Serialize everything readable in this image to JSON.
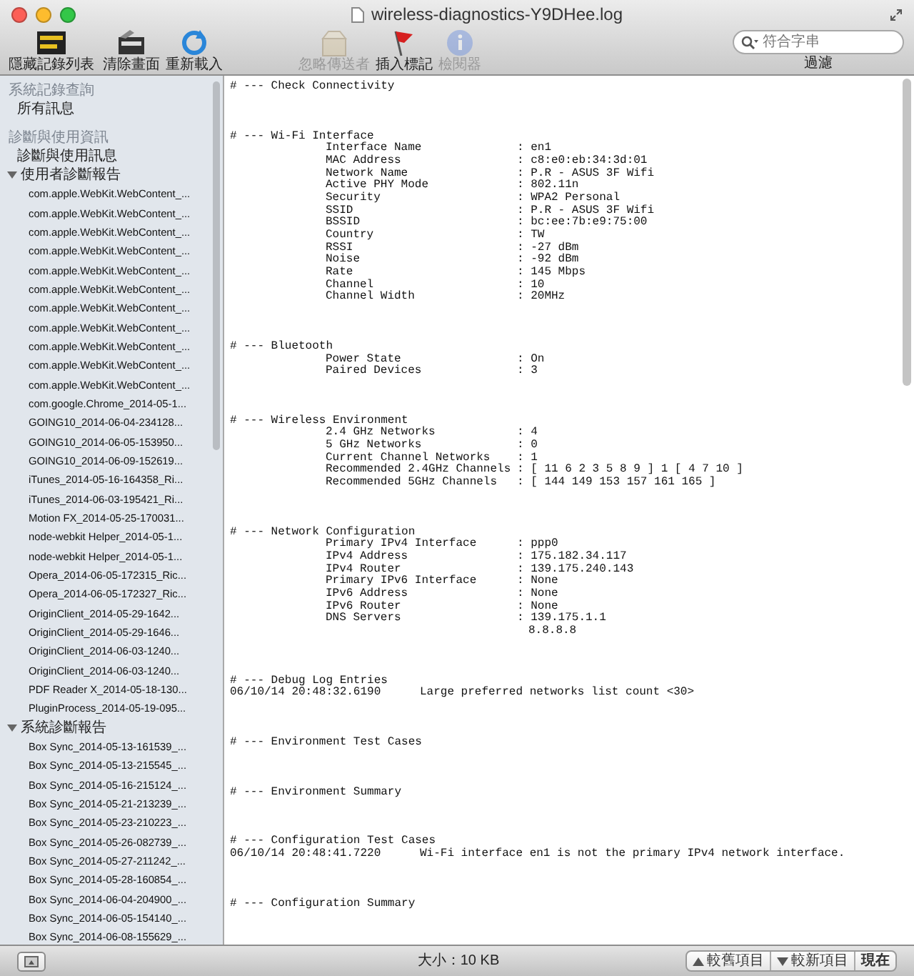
{
  "window": {
    "title": "wireless-diagnostics-Y9DHee.log"
  },
  "toolbar": {
    "buttons": [
      {
        "label": "隱藏記錄列表",
        "kind": "loglist",
        "disabled": false
      },
      {
        "label": "清除畫面",
        "kind": "clear",
        "disabled": false
      },
      {
        "label": "重新載入",
        "kind": "reload",
        "disabled": false
      },
      {
        "label": "忽略傳送者",
        "kind": "ignore",
        "disabled": true
      },
      {
        "label": "插入標記",
        "kind": "marker",
        "disabled": false
      },
      {
        "label": "檢閱器",
        "kind": "inspector",
        "disabled": true
      }
    ],
    "search": {
      "placeholder": "符合字串",
      "label": "過濾"
    }
  },
  "sidebar": {
    "sections": [
      {
        "heading": "系統記錄查詢",
        "items": [
          {
            "label": "所有訊息"
          }
        ]
      },
      {
        "heading": "診斷與使用資訊",
        "items": [
          {
            "label": "診斷與使用訊息"
          },
          {
            "label": "使用者診斷報告",
            "expanded": true,
            "children": [
              {
                "label": "com.apple.WebKit.WebContent_..."
              },
              {
                "label": "com.apple.WebKit.WebContent_..."
              },
              {
                "label": "com.apple.WebKit.WebContent_..."
              },
              {
                "label": "com.apple.WebKit.WebContent_..."
              },
              {
                "label": "com.apple.WebKit.WebContent_..."
              },
              {
                "label": "com.apple.WebKit.WebContent_..."
              },
              {
                "label": "com.apple.WebKit.WebContent_..."
              },
              {
                "label": "com.apple.WebKit.WebContent_..."
              },
              {
                "label": "com.apple.WebKit.WebContent_..."
              },
              {
                "label": "com.apple.WebKit.WebContent_..."
              },
              {
                "label": "com.apple.WebKit.WebContent_..."
              },
              {
                "label": "com.google.Chrome_2014-05-1..."
              },
              {
                "label": "GOING10_2014-06-04-234128..."
              },
              {
                "label": "GOING10_2014-06-05-153950..."
              },
              {
                "label": "GOING10_2014-06-09-152619..."
              },
              {
                "label": "iTunes_2014-05-16-164358_Ri..."
              },
              {
                "label": "iTunes_2014-06-03-195421_Ri..."
              },
              {
                "label": "Motion FX_2014-05-25-170031..."
              },
              {
                "label": "node-webkit Helper_2014-05-1..."
              },
              {
                "label": "node-webkit Helper_2014-05-1..."
              },
              {
                "label": "Opera_2014-06-05-172315_Ric..."
              },
              {
                "label": "Opera_2014-06-05-172327_Ric..."
              },
              {
                "label": "OriginClient_2014-05-29-1642..."
              },
              {
                "label": "OriginClient_2014-05-29-1646..."
              },
              {
                "label": "OriginClient_2014-06-03-1240..."
              },
              {
                "label": "OriginClient_2014-06-03-1240..."
              },
              {
                "label": "PDF Reader X_2014-05-18-130..."
              },
              {
                "label": "PluginProcess_2014-05-19-095..."
              }
            ]
          },
          {
            "label": "系統診斷報告",
            "expanded": true,
            "children": [
              {
                "label": "Box Sync_2014-05-13-161539_..."
              },
              {
                "label": "Box Sync_2014-05-13-215545_..."
              },
              {
                "label": "Box Sync_2014-05-16-215124_..."
              },
              {
                "label": "Box Sync_2014-05-21-213239_..."
              },
              {
                "label": "Box Sync_2014-05-23-210223_..."
              },
              {
                "label": "Box Sync_2014-05-26-082739_..."
              },
              {
                "label": "Box Sync_2014-05-27-211242_..."
              },
              {
                "label": "Box Sync_2014-05-28-160854_..."
              },
              {
                "label": "Box Sync_2014-06-04-204900_..."
              },
              {
                "label": "Box Sync_2014-06-05-154140_..."
              },
              {
                "label": "Box Sync_2014-06-08-155629_..."
              }
            ]
          }
        ]
      }
    ]
  },
  "log": {
    "sections": [
      {
        "heading": "# --- Check Connectivity"
      },
      {
        "heading": "# --- Wi-Fi Interface",
        "rows": [
          {
            "kind": "field",
            "label": "Interface Name",
            "value": ": en1"
          },
          {
            "kind": "field",
            "label": "MAC Address",
            "value": ": c8:e0:eb:34:3d:01"
          },
          {
            "kind": "field",
            "label": "Network Name",
            "value": ": P.R - ASUS 3F Wifi"
          },
          {
            "kind": "field",
            "label": "Active PHY Mode",
            "value": ": 802.11n"
          },
          {
            "kind": "field",
            "label": "Security",
            "value": ": WPA2 Personal"
          },
          {
            "kind": "field",
            "label": "SSID",
            "value": ": P.R - ASUS 3F Wifi"
          },
          {
            "kind": "field",
            "label": "BSSID",
            "value": ": bc:ee:7b:e9:75:00"
          },
          {
            "kind": "field",
            "label": "Country",
            "value": ": TW"
          },
          {
            "kind": "field",
            "label": "RSSI",
            "value": ": -27 dBm"
          },
          {
            "kind": "field",
            "label": "Noise",
            "value": ": -92 dBm"
          },
          {
            "kind": "field",
            "label": "Rate",
            "value": ": 145 Mbps"
          },
          {
            "kind": "field",
            "label": "Channel",
            "value": ": 10"
          },
          {
            "kind": "field",
            "label": "Channel Width",
            "value": ": 20MHz"
          }
        ]
      },
      {
        "heading": "# --- Bluetooth",
        "rows": [
          {
            "kind": "field",
            "label": "Power State",
            "value": ": On"
          },
          {
            "kind": "field",
            "label": "Paired Devices",
            "value": ": 3"
          }
        ]
      },
      {
        "heading": "# --- Wireless Environment",
        "rows": [
          {
            "kind": "field",
            "label": "2.4 GHz Networks",
            "value": ": 4"
          },
          {
            "kind": "field",
            "label": "5 GHz Networks",
            "value": ": 0"
          },
          {
            "kind": "field",
            "label": "Current Channel Networks",
            "value": ": 1"
          },
          {
            "kind": "field",
            "label": "Recommended 2.4GHz Channels",
            "value": ": [ 11 6 2 3 5 8 9 ] 1 [ 4 7 10 ]"
          },
          {
            "kind": "field",
            "label": "Recommended 5GHz Channels",
            "value": ": [ 144 149 153 157 161 165 ]"
          }
        ]
      },
      {
        "heading": "# --- Network Configuration",
        "rows": [
          {
            "kind": "field",
            "label": "Primary IPv4 Interface",
            "value": ": ppp0"
          },
          {
            "kind": "field",
            "label": "IPv4 Address",
            "value": ": 175.182.34.117"
          },
          {
            "kind": "field",
            "label": "IPv4 Router",
            "value": ": 139.175.240.143"
          },
          {
            "kind": "field",
            "label": "Primary IPv6 Interface",
            "value": ": None"
          },
          {
            "kind": "field",
            "label": "IPv6 Address",
            "value": ": None"
          },
          {
            "kind": "field",
            "label": "IPv6 Router",
            "value": ": None"
          },
          {
            "kind": "field",
            "label": "DNS Servers",
            "value": ": 139.175.1.1"
          },
          {
            "kind": "continuation",
            "value": "8.8.8.8"
          }
        ]
      },
      {
        "heading": "# --- Debug Log Entries",
        "rows": [
          {
            "kind": "entry",
            "time": "06/10/14 20:48:32.6190",
            "message": "Large preferred networks list count <30>"
          }
        ]
      },
      {
        "heading": "# --- Environment Test Cases"
      },
      {
        "heading": "# --- Environment Summary"
      },
      {
        "heading": "# --- Configuration Test Cases",
        "rows": [
          {
            "kind": "entry",
            "time": "06/10/14 20:48:41.7220",
            "message": "Wi-Fi interface en1 is not the primary IPv4 network interface."
          }
        ]
      },
      {
        "heading": "# --- Configuration Summary"
      }
    ]
  },
  "status_bar": {
    "size": "大小：10 KB",
    "buttons": [
      {
        "label": "較舊項目",
        "kind": "older"
      },
      {
        "label": "較新項目",
        "kind": "newer"
      },
      {
        "label": "現在",
        "kind": "now"
      }
    ]
  }
}
